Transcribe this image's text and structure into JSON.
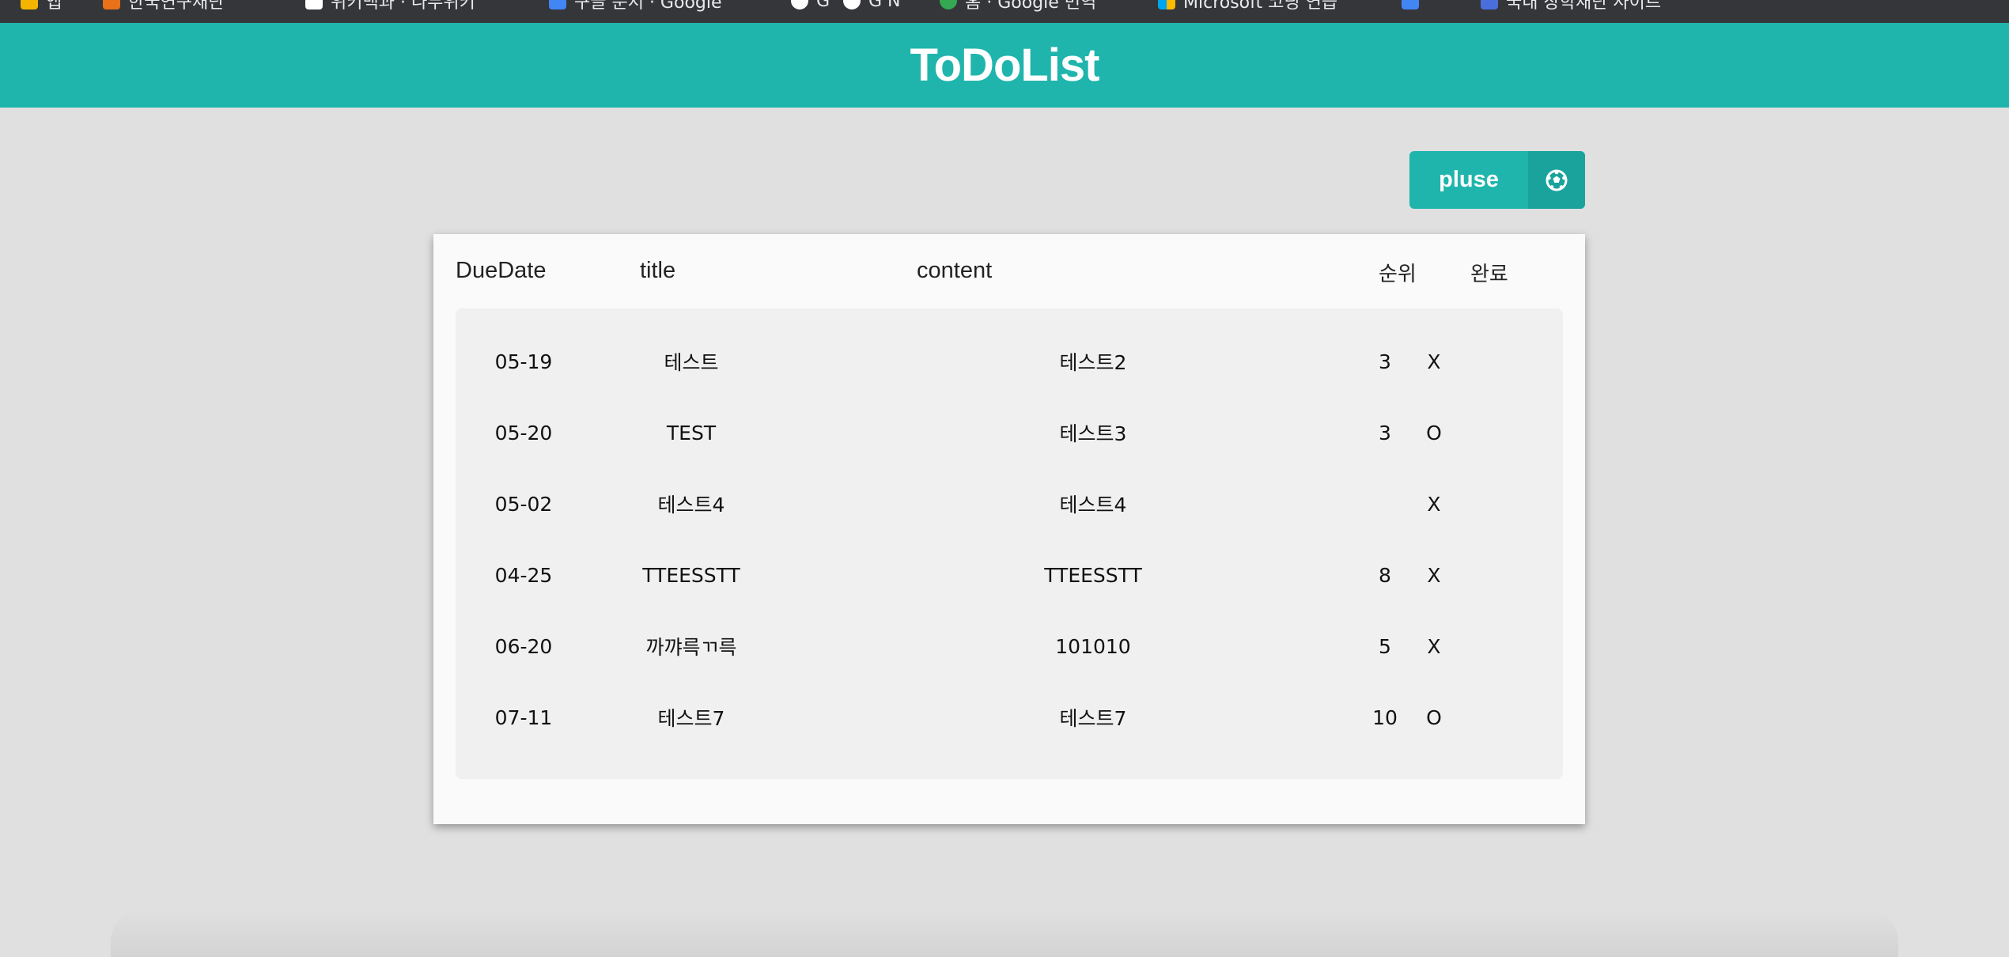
{
  "bookmarks": [
    {
      "label": "앱",
      "color": "#f4b400"
    },
    {
      "label": "한국연구재단",
      "color": "#e8711a"
    },
    {
      "label": "위키백과 · 나무위키",
      "color": "#ffffff"
    },
    {
      "label": "구글 문서 · Google",
      "color": "#4285f4"
    },
    {
      "label": "G",
      "color": "#ffffff"
    },
    {
      "label": "G  N",
      "color": "#ffffff"
    },
    {
      "label": "홈 · Google 번역",
      "color": "#34a853"
    },
    {
      "label": "Microsoft 코딩 연습",
      "color": "#f25022"
    },
    {
      "label": "",
      "color": "#4285f4"
    },
    {
      "label": "국내 장학재단 사이트",
      "color": "#4a6fdc"
    }
  ],
  "header": {
    "title": "ToDoList"
  },
  "toolbar": {
    "add_label": "pluse",
    "add_icon": "soccer-ball-icon"
  },
  "table": {
    "columns": {
      "due_date": "DueDate",
      "title": "title",
      "content": "content",
      "rank": "순위",
      "done": "완료"
    },
    "rows": [
      {
        "due_date": "05-19",
        "title": "테스트",
        "content": "테스트2",
        "rank": "3",
        "done": "X"
      },
      {
        "due_date": "05-20",
        "title": "TEST",
        "content": "테스트3",
        "rank": "3",
        "done": "O"
      },
      {
        "due_date": "05-02",
        "title": "테스트4",
        "content": "테스트4",
        "rank": "",
        "done": "X"
      },
      {
        "due_date": "04-25",
        "title": "TTEESSTT",
        "content": "TTEESSTT",
        "rank": "8",
        "done": "X"
      },
      {
        "due_date": "06-20",
        "title": "까꺄륵ㄲ륵",
        "content": "101010",
        "rank": "5",
        "done": "X"
      },
      {
        "due_date": "07-11",
        "title": "테스트7",
        "content": "테스트7",
        "rank": "10",
        "done": "O"
      }
    ]
  },
  "colors": {
    "accent": "#1fb5ad",
    "background": "#e0e0e0",
    "card": "#fafafa"
  }
}
